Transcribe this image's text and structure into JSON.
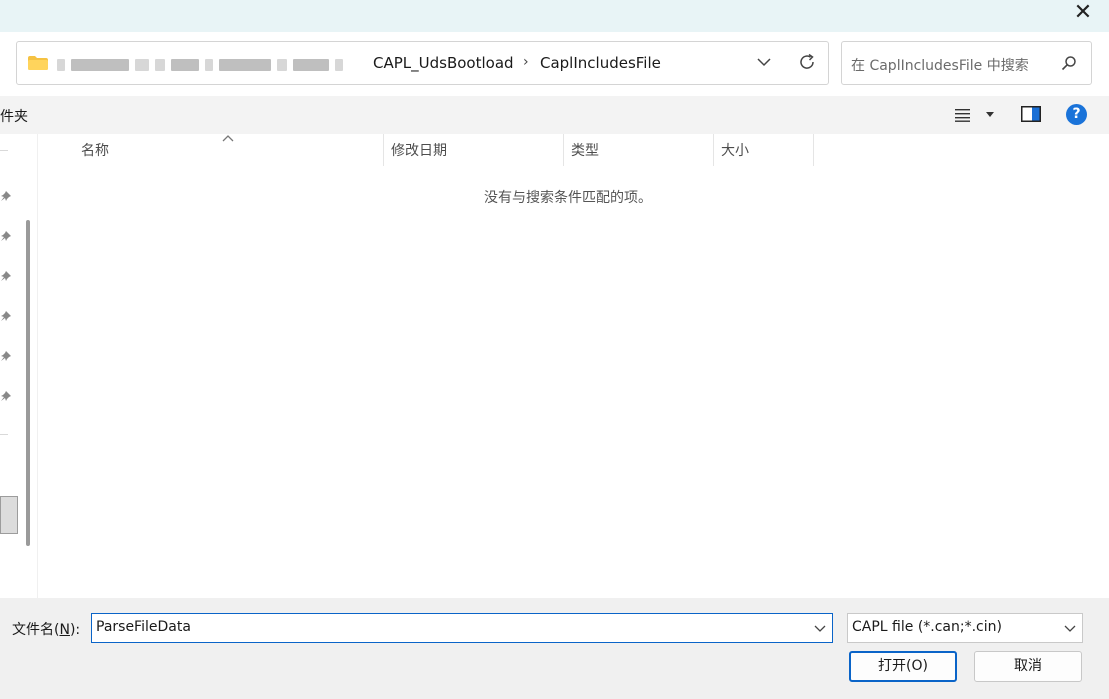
{
  "titlebar": {
    "close_glyph": "✕"
  },
  "address": {
    "crumbs": [
      "CAPL_UdsBootload",
      "CaplIncludesFile"
    ],
    "separator": "›",
    "dropdown_icon": "chevron-down-icon",
    "refresh_icon": "refresh-icon"
  },
  "search": {
    "placeholder": "在 CaplIncludesFile 中搜索"
  },
  "toolbar": {
    "partial_label": "件夹",
    "help_glyph": "?"
  },
  "columns": [
    {
      "label": "名称"
    },
    {
      "label": "修改日期"
    },
    {
      "label": "类型"
    },
    {
      "label": "大小"
    }
  ],
  "file_list": {
    "empty_message": "没有与搜索条件匹配的项。"
  },
  "footer": {
    "filename_label_prefix": "文件名(",
    "filename_label_key": "N",
    "filename_label_suffix": "):",
    "filename_value": "ParseFileData",
    "filter_value": "CAPL file (*.can;*.cin)",
    "open_label": "打开(O)",
    "cancel_label": "取消"
  },
  "colors": {
    "accent": "#0a64c8",
    "titlebar": "#e8f4f6",
    "folder": "#f5c242",
    "help": "#1a73d9"
  }
}
